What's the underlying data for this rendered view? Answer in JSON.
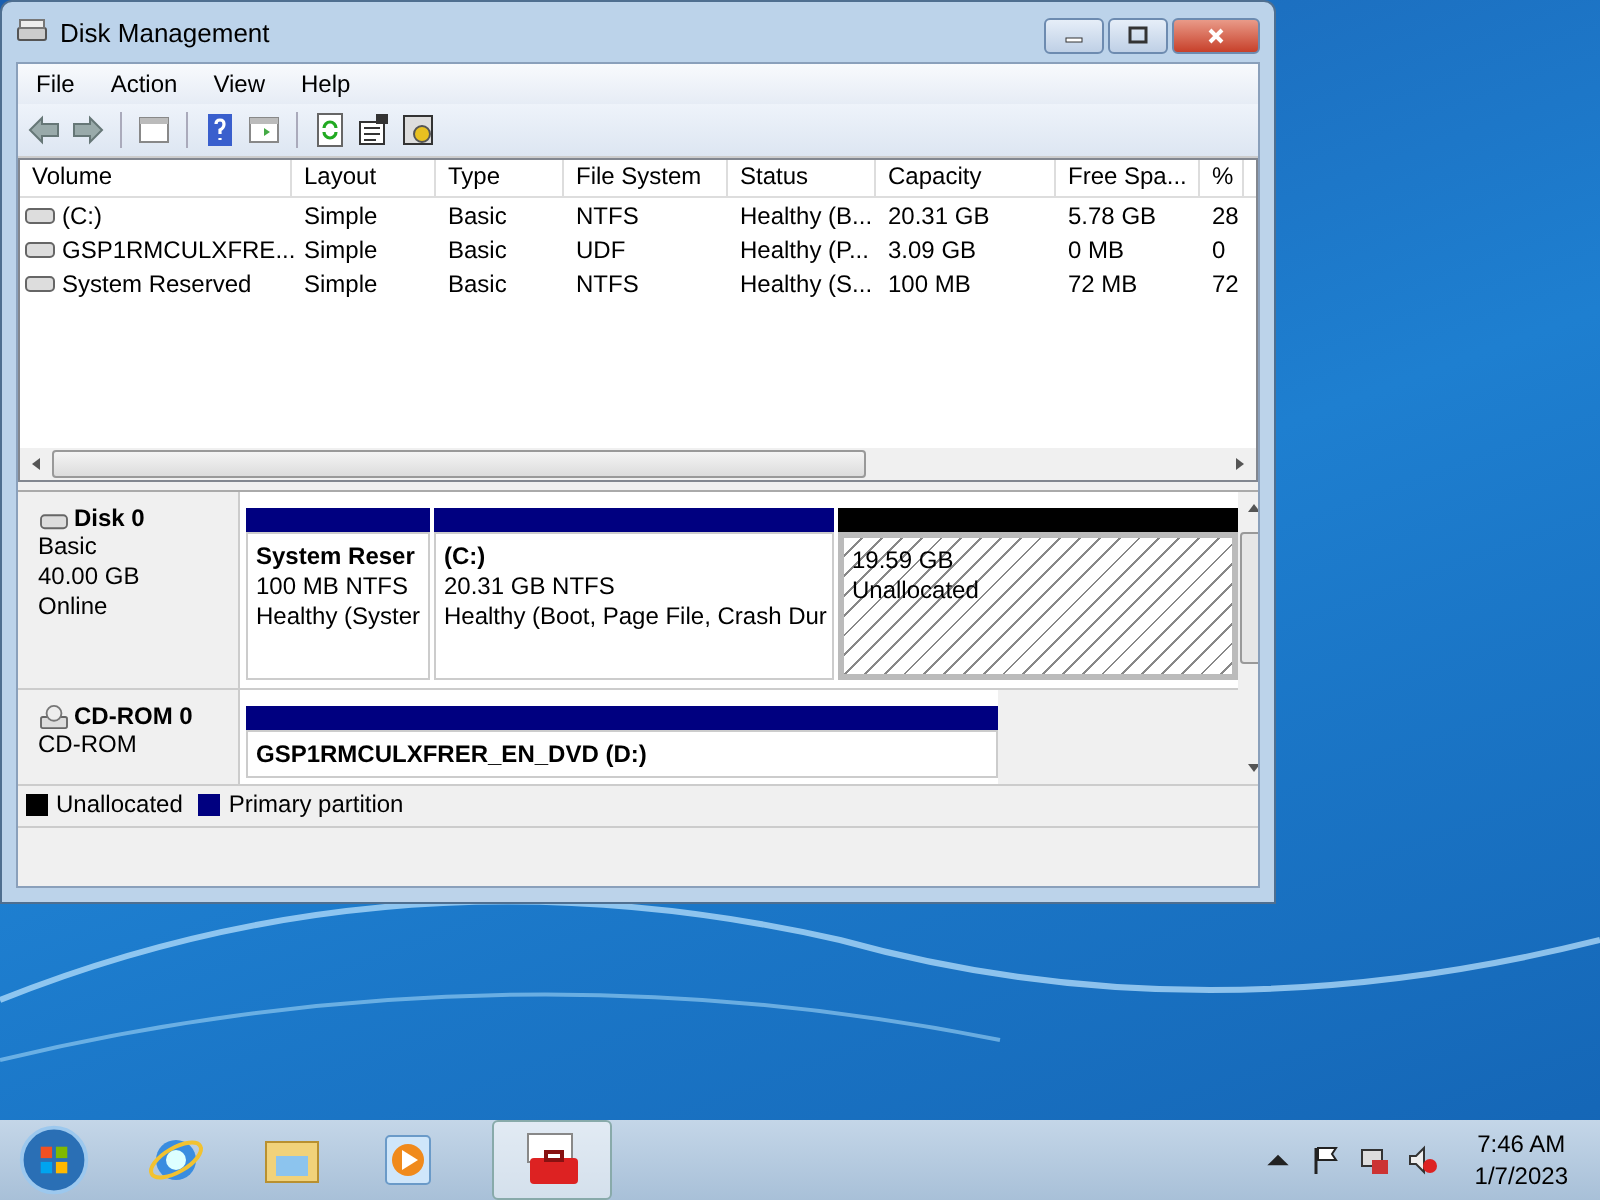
{
  "window": {
    "title": "Disk Management"
  },
  "menu": [
    "File",
    "Action",
    "View",
    "Help"
  ],
  "volumes": {
    "columns": [
      "Volume",
      "Layout",
      "Type",
      "File System",
      "Status",
      "Capacity",
      "Free Spa...",
      "%"
    ],
    "rows": [
      [
        "(C:)",
        "Simple",
        "Basic",
        "NTFS",
        "Healthy (B...",
        "20.31 GB",
        "5.78 GB",
        "28"
      ],
      [
        "GSP1RMCULXFRE...",
        "Simple",
        "Basic",
        "UDF",
        "Healthy (P...",
        "3.09 GB",
        "0 MB",
        "0"
      ],
      [
        "System Reserved",
        "Simple",
        "Basic",
        "NTFS",
        "Healthy (S...",
        "100 MB",
        "72 MB",
        "72"
      ]
    ]
  },
  "disks": [
    {
      "name": "Disk 0",
      "kind": "disk",
      "lines": [
        "Basic",
        "40.00 GB",
        "Online"
      ],
      "partitions": [
        {
          "kind": "primary",
          "name": "System Reser",
          "lines": [
            "100 MB NTFS",
            "Healthy (Syster"
          ]
        },
        {
          "kind": "primary",
          "name": "(C:)",
          "lines": [
            "20.31 GB NTFS",
            "Healthy (Boot, Page File, Crash Dur"
          ]
        },
        {
          "kind": "unallocated",
          "lines": [
            "19.59 GB",
            "Unallocated"
          ]
        }
      ]
    },
    {
      "name": "CD-ROM 0",
      "kind": "cdrom",
      "lines": [
        "CD-ROM"
      ],
      "partitions": [
        {
          "kind": "primary",
          "name": "GSP1RMCULXFRER_EN_DVD (D:)"
        }
      ]
    }
  ],
  "legend": [
    {
      "label": "Unallocated",
      "color": "#000000"
    },
    {
      "label": "Primary partition",
      "color": "#000080"
    }
  ],
  "taskbar": {
    "time": "7:46 AM",
    "date": "1/7/2023"
  }
}
